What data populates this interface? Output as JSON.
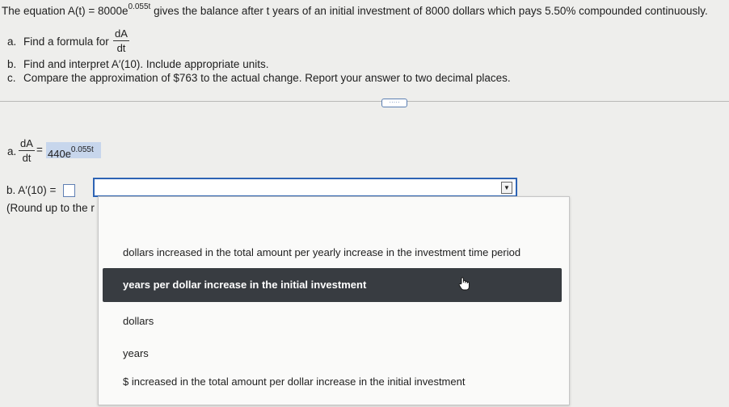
{
  "question": {
    "intro_pre": "The equation A(t) = 8000e",
    "intro_exp": "0.055t",
    "intro_post": " gives the balance after t years of an initial investment of  8000 dollars which pays 5.50% compounded continuously.",
    "part_a_letter": "a.",
    "part_a_text": "Find a formula for",
    "part_b_letter": "b.",
    "part_b_text": "Find and interpret A′(10). Include appropriate units.",
    "part_c_letter": "c.",
    "part_c_text": "Compare the approximation of $763 to the actual change. Report your answer to two decimal places.",
    "deriv_num": "dA",
    "deriv_den": "dt"
  },
  "more_button": "·····",
  "answer": {
    "a_letter": "a.",
    "a_num": "dA",
    "a_den": "dt",
    "a_equals": "=",
    "a_value_base": "440e",
    "a_value_exp": "0.055t",
    "b_label": "b. A′(10) =",
    "b_note": "(Round up to the r"
  },
  "dropdown": {
    "arrow_glyph": "▼",
    "options": [
      "dollars increased in the total amount per yearly increase in the investment time period",
      "years per dollar increase in the initial investment",
      "dollars",
      "years",
      "$ increased in the total amount per dollar increase in the initial investment"
    ],
    "highlighted_index": 1
  }
}
